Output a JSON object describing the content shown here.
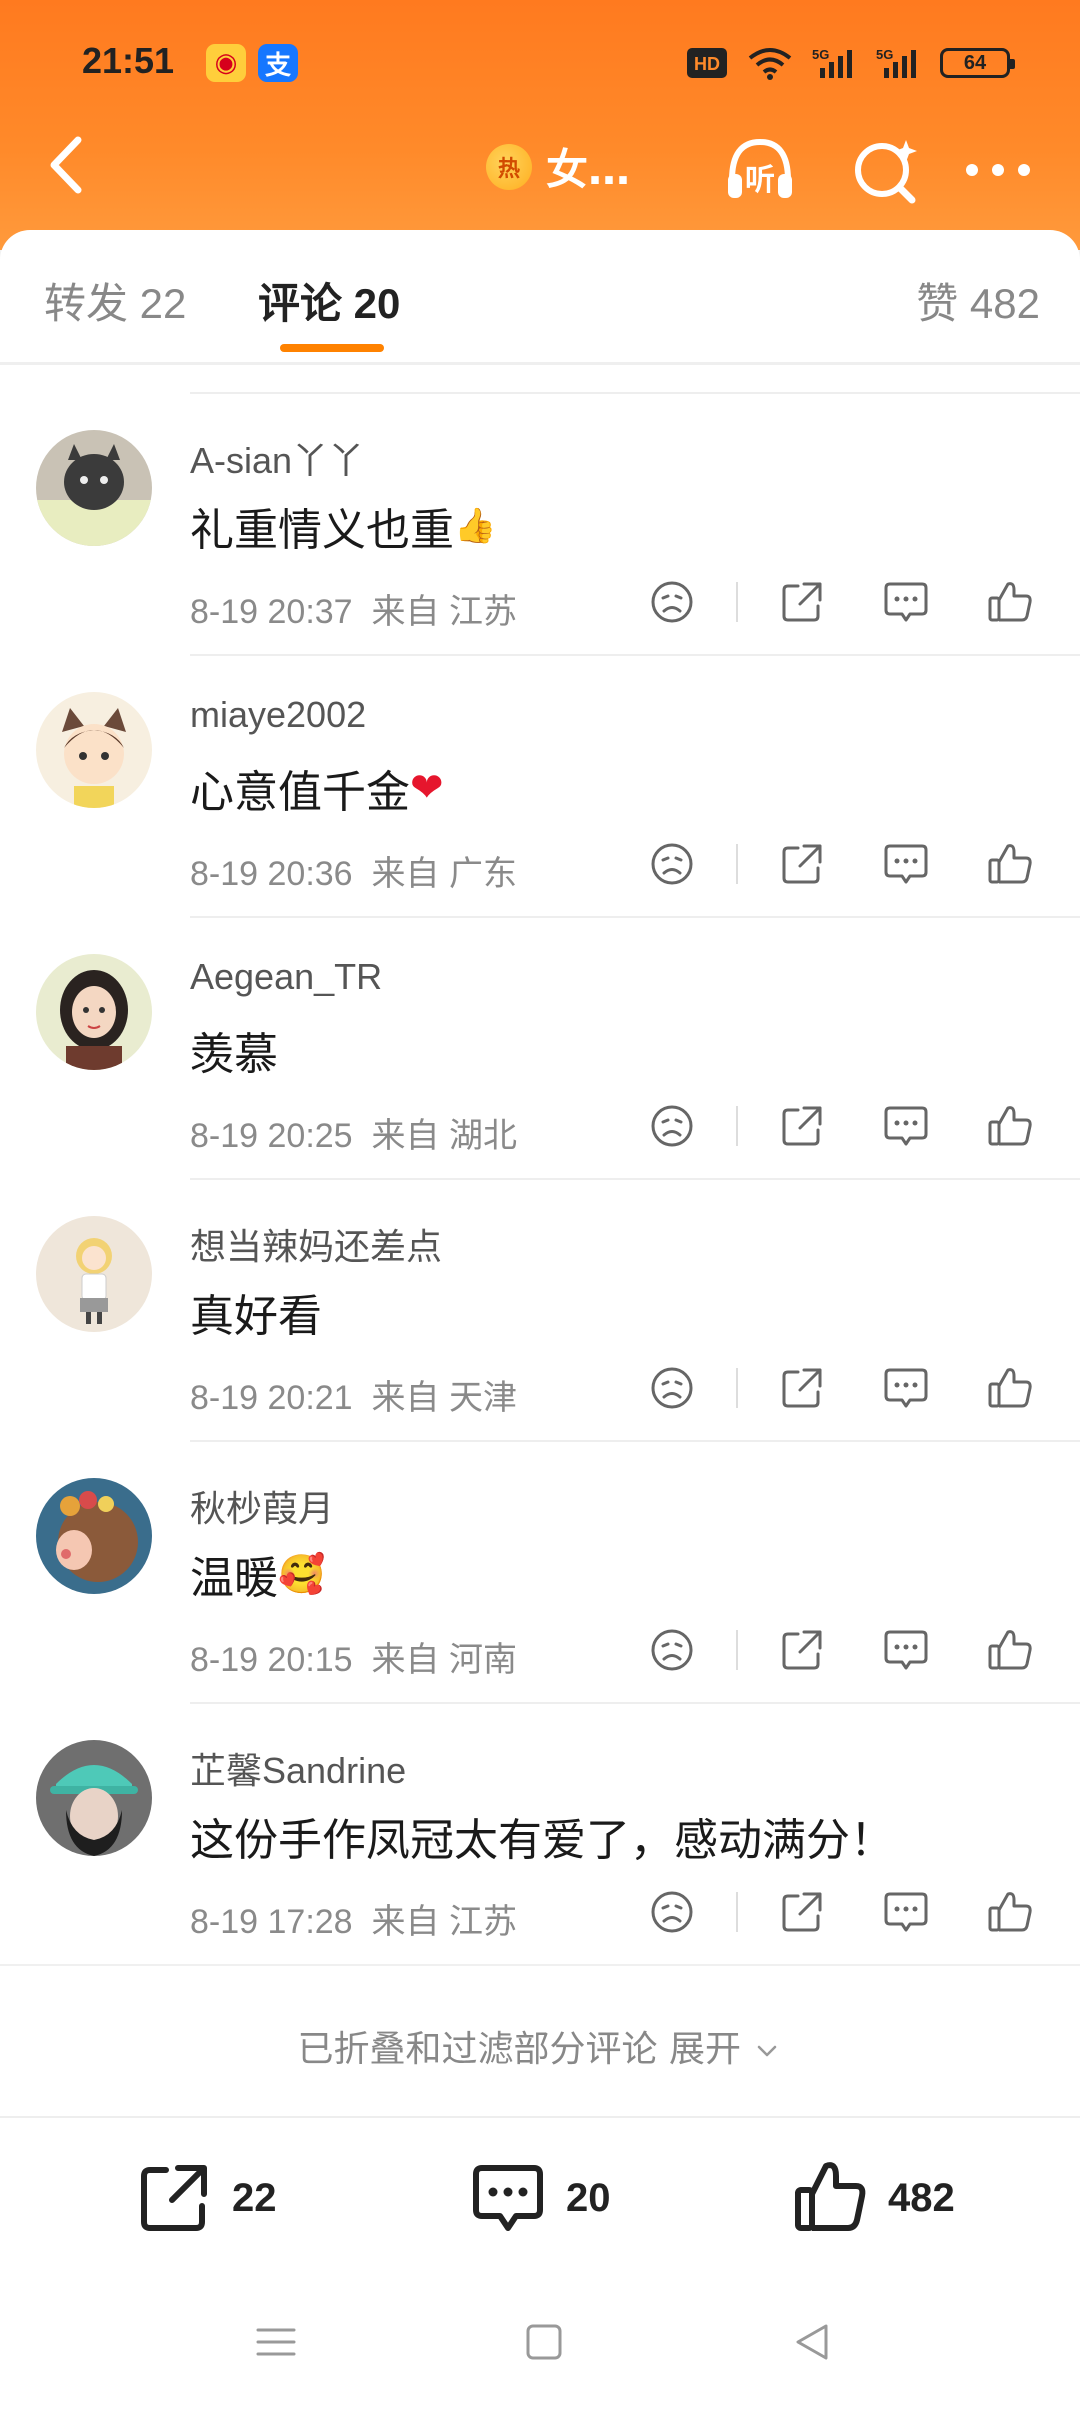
{
  "status_bar": {
    "time": "21:51",
    "battery": "64",
    "network_hd": "HD",
    "network_5g": "5G"
  },
  "navbar": {
    "topic": "女…",
    "hot_badge": "热",
    "listen_label": "听"
  },
  "tabs": {
    "repost": "转发 22",
    "comment": "评论 20",
    "like": "赞 482"
  },
  "comments": [
    {
      "user": "A-sian丫丫",
      "text": "礼重情义也重",
      "emoji": "👍",
      "time": "8-19 20:37",
      "from": "来自 江苏"
    },
    {
      "user": "miaye2002",
      "text": "心意值千金",
      "emoji": "❤",
      "time": "8-19 20:36",
      "from": "来自 广东"
    },
    {
      "user": "Aegean_TR",
      "text": "羡慕",
      "emoji": "",
      "time": "8-19 20:25",
      "from": "来自 湖北"
    },
    {
      "user": "想当辣妈还差点",
      "text": "真好看",
      "emoji": "",
      "time": "8-19 20:21",
      "from": "来自 天津"
    },
    {
      "user": "秋杪葭月",
      "text": "温暖",
      "emoji": "🥰",
      "time": "8-19 20:15",
      "from": "来自 河南"
    },
    {
      "user": "芷馨Sandrine",
      "text": "这份手作凤冠太有爱了，感动满分！",
      "emoji": "",
      "time": "8-19 17:28",
      "from": "来自 江苏"
    }
  ],
  "collapse": {
    "text": "已折叠和过滤部分评论 展开"
  },
  "bottom_bar": {
    "repost_count": "22",
    "comment_count": "20",
    "like_count": "482"
  },
  "colors": {
    "header_orange": "#ff7a1f",
    "tab_indicator": "#ff8200"
  }
}
